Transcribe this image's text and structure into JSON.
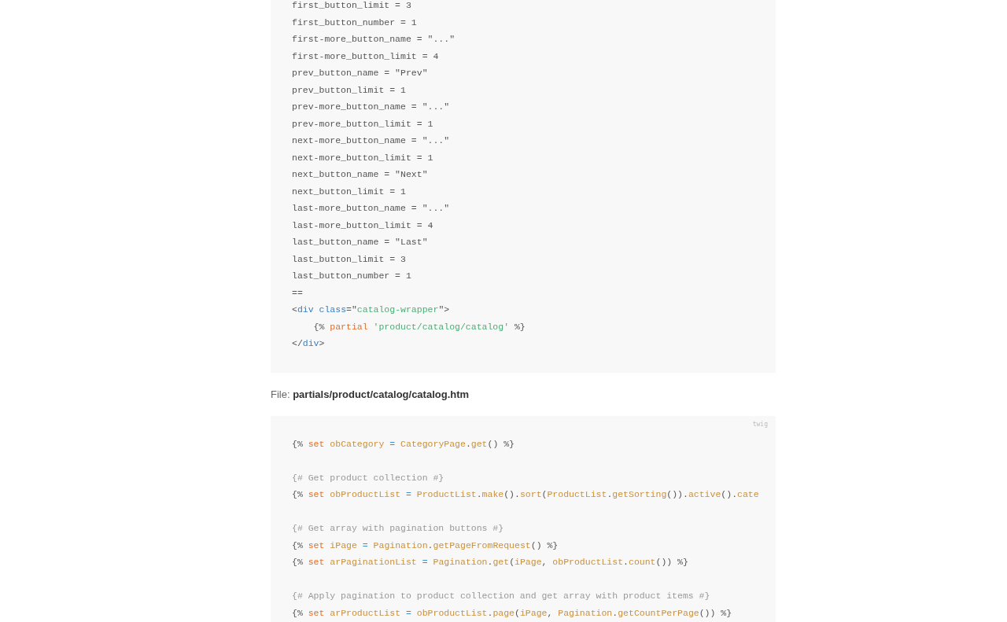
{
  "code_blocks": [
    {
      "lines": [
        {
          "kind": "code",
          "tokens": [
            {
              "kind": "plain",
              "text": "first_button_limit = 3"
            }
          ]
        },
        {
          "kind": "code",
          "tokens": [
            {
              "kind": "plain",
              "text": "first_button_number = 1"
            }
          ]
        },
        {
          "kind": "code",
          "tokens": [
            {
              "kind": "plain",
              "text": "first-more_button_name = \"...\""
            }
          ]
        },
        {
          "kind": "code",
          "tokens": [
            {
              "kind": "plain",
              "text": "first-more_button_limit = 4"
            }
          ]
        },
        {
          "kind": "code",
          "tokens": [
            {
              "kind": "plain",
              "text": "prev_button_name = \"Prev\""
            }
          ]
        },
        {
          "kind": "code",
          "tokens": [
            {
              "kind": "plain",
              "text": "prev_button_limit = 1"
            }
          ]
        },
        {
          "kind": "code",
          "tokens": [
            {
              "kind": "plain",
              "text": "prev-more_button_name = \"...\""
            }
          ]
        },
        {
          "kind": "code",
          "tokens": [
            {
              "kind": "plain",
              "text": "prev-more_button_limit = 1"
            }
          ]
        },
        {
          "kind": "code",
          "tokens": [
            {
              "kind": "plain",
              "text": "next-more_button_name = \"...\""
            }
          ]
        },
        {
          "kind": "code",
          "tokens": [
            {
              "kind": "plain",
              "text": "next-more_button_limit = 1"
            }
          ]
        },
        {
          "kind": "code",
          "tokens": [
            {
              "kind": "plain",
              "text": "next_button_name = \"Next\""
            }
          ]
        },
        {
          "kind": "code",
          "tokens": [
            {
              "kind": "plain",
              "text": "next_button_limit = 1"
            }
          ]
        },
        {
          "kind": "code",
          "tokens": [
            {
              "kind": "plain",
              "text": "last-more_button_name = \"...\""
            }
          ]
        },
        {
          "kind": "code",
          "tokens": [
            {
              "kind": "plain",
              "text": "last-more_button_limit = 4"
            }
          ]
        },
        {
          "kind": "code",
          "tokens": [
            {
              "kind": "plain",
              "text": "last_button_name = \"Last\""
            }
          ]
        },
        {
          "kind": "code",
          "tokens": [
            {
              "kind": "plain",
              "text": "last_button_limit = 3"
            }
          ]
        },
        {
          "kind": "code",
          "tokens": [
            {
              "kind": "plain",
              "text": "last_button_number = 1"
            }
          ]
        },
        {
          "kind": "code",
          "tokens": [
            {
              "kind": "plain",
              "text": "=="
            }
          ]
        },
        {
          "kind": "code",
          "tokens": [
            {
              "kind": "plain",
              "text": "<"
            },
            {
              "kind": "tag",
              "text": "div"
            },
            {
              "kind": "attr",
              "text": " class"
            },
            {
              "kind": "plain",
              "text": "=\""
            },
            {
              "kind": "string",
              "text": "catalog-wrapper"
            },
            {
              "kind": "plain",
              "text": "\">"
            }
          ]
        },
        {
          "kind": "code",
          "tokens": [
            {
              "kind": "plain",
              "text": "    {% "
            },
            {
              "kind": "keyword",
              "text": "partial"
            },
            {
              "kind": "string",
              "text": " 'product/catalog/catalog'"
            },
            {
              "kind": "plain",
              "text": " %}"
            }
          ]
        },
        {
          "kind": "code",
          "tokens": [
            {
              "kind": "plain",
              "text": "</"
            },
            {
              "kind": "tag",
              "text": "div"
            },
            {
              "kind": "plain",
              "text": ">"
            }
          ]
        }
      ]
    },
    {
      "caption": "File: **partials/product/catalog/catalog.htm**",
      "language": "twig",
      "lines": [
        {
          "kind": "code",
          "tokens": [
            {
              "kind": "plain",
              "text": "{% "
            },
            {
              "kind": "keyword",
              "text": "set"
            },
            {
              "kind": "name",
              "text": " obCategory"
            },
            {
              "kind": "operator",
              "text": " ="
            },
            {
              "kind": "name",
              "text": " CategoryPage"
            },
            {
              "kind": "plain",
              "text": "."
            },
            {
              "kind": "name",
              "text": "get"
            },
            {
              "kind": "plain",
              "text": "() %}"
            }
          ]
        },
        {
          "kind": "blank"
        },
        {
          "kind": "code",
          "tokens": [
            {
              "kind": "comment",
              "text": "{# Get product collection #}"
            }
          ]
        },
        {
          "kind": "code",
          "tokens": [
            {
              "kind": "plain",
              "text": "{% "
            },
            {
              "kind": "keyword",
              "text": "set"
            },
            {
              "kind": "name",
              "text": " obProductList"
            },
            {
              "kind": "operator",
              "text": " ="
            },
            {
              "kind": "name",
              "text": " ProductList"
            },
            {
              "kind": "plain",
              "text": "."
            },
            {
              "kind": "name",
              "text": "make"
            },
            {
              "kind": "plain",
              "text": "()."
            },
            {
              "kind": "name",
              "text": "sort"
            },
            {
              "kind": "plain",
              "text": "("
            },
            {
              "kind": "name",
              "text": "ProductList"
            },
            {
              "kind": "plain",
              "text": "."
            },
            {
              "kind": "name",
              "text": "getSorting"
            },
            {
              "kind": "plain",
              "text": "())."
            },
            {
              "kind": "name",
              "text": "active"
            },
            {
              "kind": "plain",
              "text": "()."
            },
            {
              "kind": "name",
              "text": "cate"
            }
          ]
        },
        {
          "kind": "blank"
        },
        {
          "kind": "code",
          "tokens": [
            {
              "kind": "comment",
              "text": "{# Get array with pagination buttons #}"
            }
          ]
        },
        {
          "kind": "code",
          "tokens": [
            {
              "kind": "plain",
              "text": "{% "
            },
            {
              "kind": "keyword",
              "text": "set"
            },
            {
              "kind": "name",
              "text": " iPage"
            },
            {
              "kind": "operator",
              "text": " ="
            },
            {
              "kind": "name",
              "text": " Pagination"
            },
            {
              "kind": "plain",
              "text": "."
            },
            {
              "kind": "name",
              "text": "getPageFromRequest"
            },
            {
              "kind": "plain",
              "text": "() %}"
            }
          ]
        },
        {
          "kind": "code",
          "tokens": [
            {
              "kind": "plain",
              "text": "{% "
            },
            {
              "kind": "keyword",
              "text": "set"
            },
            {
              "kind": "name",
              "text": " arPaginationList"
            },
            {
              "kind": "operator",
              "text": " ="
            },
            {
              "kind": "name",
              "text": " Pagination"
            },
            {
              "kind": "plain",
              "text": "."
            },
            {
              "kind": "name",
              "text": "get"
            },
            {
              "kind": "plain",
              "text": "("
            },
            {
              "kind": "name",
              "text": "iPage"
            },
            {
              "kind": "plain",
              "text": ", "
            },
            {
              "kind": "name",
              "text": "obProductList"
            },
            {
              "kind": "plain",
              "text": "."
            },
            {
              "kind": "name",
              "text": "count"
            },
            {
              "kind": "plain",
              "text": "()) %}"
            }
          ]
        },
        {
          "kind": "blank"
        },
        {
          "kind": "code",
          "tokens": [
            {
              "kind": "comment",
              "text": "{# Apply pagination to product collection and get array with product items #}"
            }
          ]
        },
        {
          "kind": "code",
          "tokens": [
            {
              "kind": "plain",
              "text": "{% "
            },
            {
              "kind": "keyword",
              "text": "set"
            },
            {
              "kind": "name",
              "text": " arProductList"
            },
            {
              "kind": "operator",
              "text": " ="
            },
            {
              "kind": "name",
              "text": " obProductList"
            },
            {
              "kind": "plain",
              "text": "."
            },
            {
              "kind": "name",
              "text": "page"
            },
            {
              "kind": "plain",
              "text": "("
            },
            {
              "kind": "name",
              "text": "iPage"
            },
            {
              "kind": "plain",
              "text": ", "
            },
            {
              "kind": "name",
              "text": "Pagination"
            },
            {
              "kind": "plain",
              "text": "."
            },
            {
              "kind": "name",
              "text": "getCountPerPage"
            },
            {
              "kind": "plain",
              "text": "()) %}"
            }
          ]
        }
      ]
    }
  ]
}
